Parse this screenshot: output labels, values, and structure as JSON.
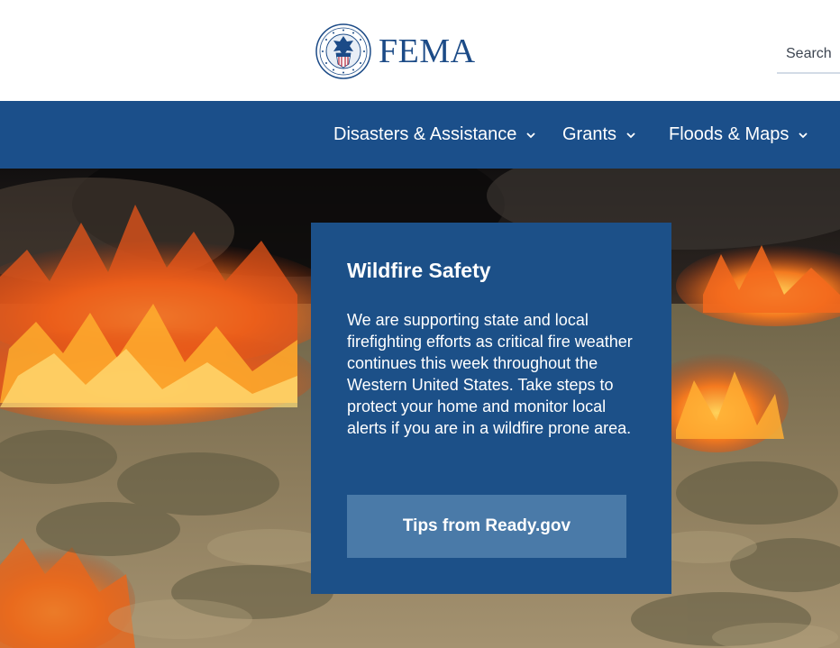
{
  "header": {
    "logo_text": "FEMA",
    "search_placeholder": "Search"
  },
  "nav": {
    "items": [
      {
        "label": "Disasters & Assistance",
        "icon": "chevron-down-icon"
      },
      {
        "label": "Grants",
        "icon": "chevron-down-icon"
      },
      {
        "label": "Floods & Maps",
        "icon": "chevron-down-icon"
      }
    ]
  },
  "hero": {
    "image_subject": "wildfire burning through sagebrush field",
    "card": {
      "title": "Wildfire Safety",
      "body": "We are supporting state and local firefighting efforts as critical fire weather continues this week throughout the Western United States. Take steps to protect your home and monitor local alerts if you are in a wildfire prone area.",
      "button_label": "Tips from Ready.gov"
    }
  },
  "colors": {
    "brand_blue": "#1b4f8a",
    "logo_text": "#1c4b87",
    "card_bg": "#1c5088",
    "button_bg": "#4a7aa8"
  }
}
